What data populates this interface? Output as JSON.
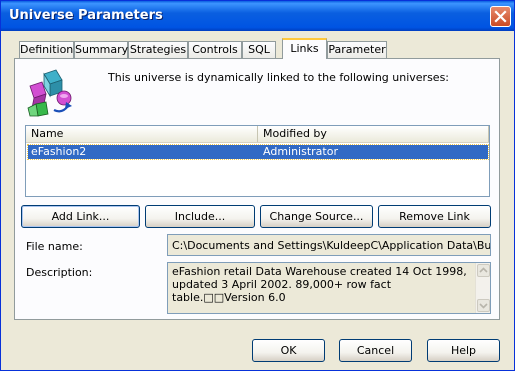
{
  "window": {
    "title": "Universe Parameters"
  },
  "tabs": [
    {
      "label": "Definition",
      "active": false
    },
    {
      "label": "Summary",
      "active": false
    },
    {
      "label": "Strategies",
      "active": false
    },
    {
      "label": "Controls",
      "active": false
    },
    {
      "label": "SQL",
      "active": false
    },
    {
      "label": "Links",
      "active": true
    },
    {
      "label": "Parameter",
      "active": false
    }
  ],
  "links_tab": {
    "intro": "This universe is dynamically linked to the following universes:",
    "icon": "universe-link-icon",
    "list": {
      "columns": [
        "Name",
        "Modified by"
      ],
      "rows": [
        {
          "name": "eFashion2",
          "modified_by": "Administrator",
          "selected": true
        }
      ]
    },
    "buttons": {
      "add_link": "Add Link...",
      "include": "Include...",
      "change_source": "Change Source...",
      "remove_link": "Remove Link"
    },
    "file_name_label": "File name:",
    "file_name_value": "C:\\Documents and Settings\\KuldeepC\\Application Data\\Business O",
    "description_label": "Description:",
    "description_value": "eFashion retail Data Warehouse created 14 Oct 1998, updated 3 April 2002. 89,000+ row fact table.□□Version 6.0"
  },
  "footer": {
    "ok": "OK",
    "cancel": "Cancel",
    "help": "Help"
  },
  "colors": {
    "titlebar": "#0054e3",
    "selection": "#316ac5",
    "dialog_bg": "#ece9d8",
    "active_tab_accent": "#ffc83c"
  }
}
